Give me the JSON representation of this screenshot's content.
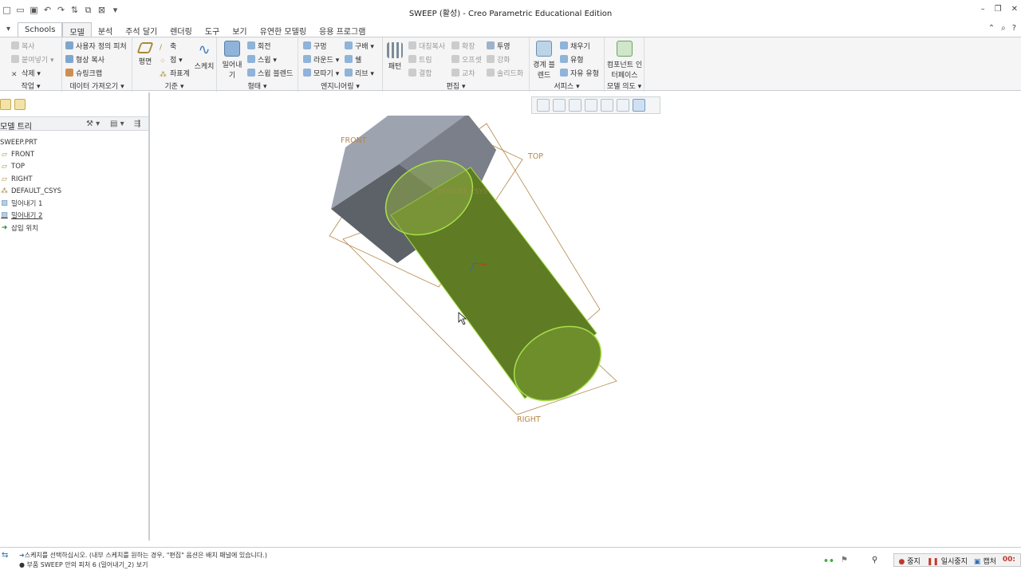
{
  "window": {
    "title": "SWEEP (활성) - Creo Parametric Educational Edition"
  },
  "tabs": [
    {
      "label": "Schools"
    },
    {
      "label": "모델"
    },
    {
      "label": "분석"
    },
    {
      "label": "주석 달기"
    },
    {
      "label": "렌더링"
    },
    {
      "label": "도구"
    },
    {
      "label": "보기"
    },
    {
      "label": "유연한 모델링"
    },
    {
      "label": "응용 프로그램"
    }
  ],
  "ribbon": {
    "operations": {
      "copy": "복사",
      "paste": "붙여넣기",
      "delete": "삭제",
      "label": "작업"
    },
    "get_data": {
      "udf": "사용자 정의 피처",
      "copy_geom": "형상 복사",
      "shrinkwrap": "슈링크랩",
      "label": "데이터 가져오기"
    },
    "datum": {
      "plane": "평면",
      "axis": "축",
      "point": "점",
      "csys": "좌표계",
      "sketch": "스케치",
      "label": "기준"
    },
    "shapes": {
      "extrude": "밀어내기",
      "revolve": "회전",
      "sweep": "스윕",
      "swept_blend": "스윕 블렌드",
      "label": "형태"
    },
    "engineering": {
      "hole": "구멍",
      "round": "라운드",
      "chamfer": "모따기",
      "draft": "구배",
      "shell": "쉘",
      "rib": "리브",
      "label": "엔지니어링"
    },
    "editing": {
      "pattern": "패턴",
      "mirror": "대칭복사",
      "trim": "트림",
      "merge": "결합",
      "extend": "확장",
      "offset": "오프셋",
      "intersect": "교차",
      "project": "투영",
      "thicken": "강화",
      "solidify": "솔리드화",
      "label": "편집"
    },
    "surfaces": {
      "boundary_blend": "경계 블렌드",
      "fill": "채우기",
      "style": "유형",
      "freestyle": "자유 유형",
      "label": "서피스"
    },
    "model_intent": {
      "component_interface": "컴포넌트 인터페이스",
      "label": "모델 의도"
    }
  },
  "model_tree": {
    "header": "모델 트리",
    "items": [
      {
        "label": "SWEEP.PRT",
        "icon": "part-icon"
      },
      {
        "label": "FRONT",
        "icon": "datum-plane-icon"
      },
      {
        "label": "TOP",
        "icon": "datum-plane-icon"
      },
      {
        "label": "RIGHT",
        "icon": "datum-plane-icon"
      },
      {
        "label": "DEFAULT_CSYS",
        "icon": "csys-icon"
      },
      {
        "label": "밀어내기 1",
        "icon": "extrude-icon"
      },
      {
        "label": "밀어내기 2",
        "icon": "extrude-icon"
      },
      {
        "label": "삽입 위치",
        "icon": "insert-arrow-icon"
      }
    ]
  },
  "viewport": {
    "datum_labels": {
      "front": "FRONT",
      "top": "TOP",
      "right": "RIGHT",
      "csys": "DEFAULT_CSYS"
    },
    "colors": {
      "hex_face_top": "#9ea3b0",
      "hex_face_side": "#5d6168",
      "cylinder": "#6b8a2a",
      "cylinder_edge": "#a7e04a",
      "datum": "#b5864a"
    }
  },
  "status": {
    "message1": "스케치를 선택하십시오. (내부 스케치를 원하는 경우, \"편집\" 옵션은 배치 패널에 있습니다.)",
    "message2": "● 부품 SWEEP 안의 피처 6 (밀어내기_2) 보기"
  },
  "recorder": {
    "stop": "중지",
    "pause": "일시중지",
    "capture": "캡처",
    "time": "00:"
  }
}
